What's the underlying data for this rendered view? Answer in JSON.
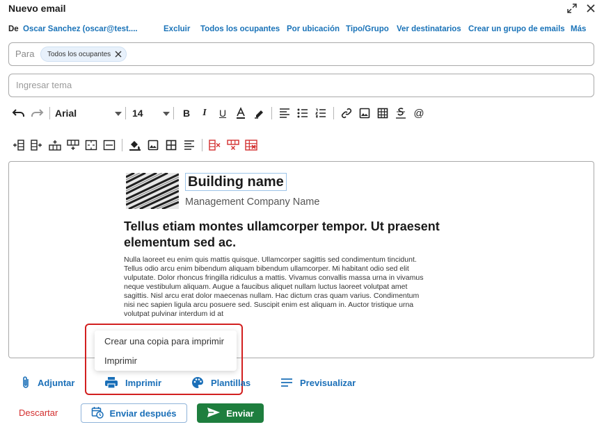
{
  "header": {
    "title": "Nuevo email",
    "expand_icon": "expand-icon",
    "close_icon": "close-icon"
  },
  "from_row": {
    "de_label": "De",
    "sender": "Oscar Sanchez (oscar@test....",
    "links": [
      "Excluir",
      "Todos los ocupantes",
      "Por ubicación",
      "Tipo/Grupo",
      "Ver destinatarios",
      "Crear un grupo de emails",
      "Más"
    ]
  },
  "to_field": {
    "label": "Para",
    "chips": [
      {
        "label": "Todos los ocupantes"
      }
    ]
  },
  "subject_field": {
    "placeholder": "Ingresar tema",
    "value": ""
  },
  "toolbar1": {
    "font": "Arial",
    "size": "14"
  },
  "editor": {
    "building_name": "Building name",
    "management_company": "Management Company Name",
    "headline": "Tellus etiam montes ullamcorper tempor. Ut praesent elementum sed ac.",
    "body_lines": [
      "Nulla laoreet eu enim quis mattis quisque. Ullamcorper sagittis sed condimentum tincidunt.",
      "Tellus odio arcu enim bibendum aliquam bibendum ullamcorper. Mi habitant odio sed elit",
      "vulputate. Dolor rhoncus fringilla ridiculus a mattis. Vivamus convallis massa urna in vivamus",
      "neque vestibulum aliquam. Augue a faucibus aliquet nullam luctus laoreet volutpat amet",
      "sagittis. Nisl arcu erat dolor maecenas nullam. Hac dictum cras quam varius. Condimentum",
      "nisi nec sapien ligula arcu posuere sed. Suscipit enim est aliquam in. Auctor tristique urna",
      "volutpat pulvinar interdum id at"
    ]
  },
  "print_menu": {
    "items": [
      "Crear una copia para imprimir",
      "Imprimir"
    ]
  },
  "actions": {
    "attach": "Adjuntar",
    "print": "Imprimir",
    "templates": "Plantillas",
    "preview": "Previsualizar"
  },
  "footer": {
    "discard": "Descartar",
    "send_later": "Enviar después",
    "send": "Enviar"
  },
  "colors": {
    "link": "#1a6fb8",
    "send_bg": "#1e7e3e",
    "discard": "#d32f2f",
    "highlight": "#d21f1f",
    "chip_bg": "#e8f1fb"
  }
}
